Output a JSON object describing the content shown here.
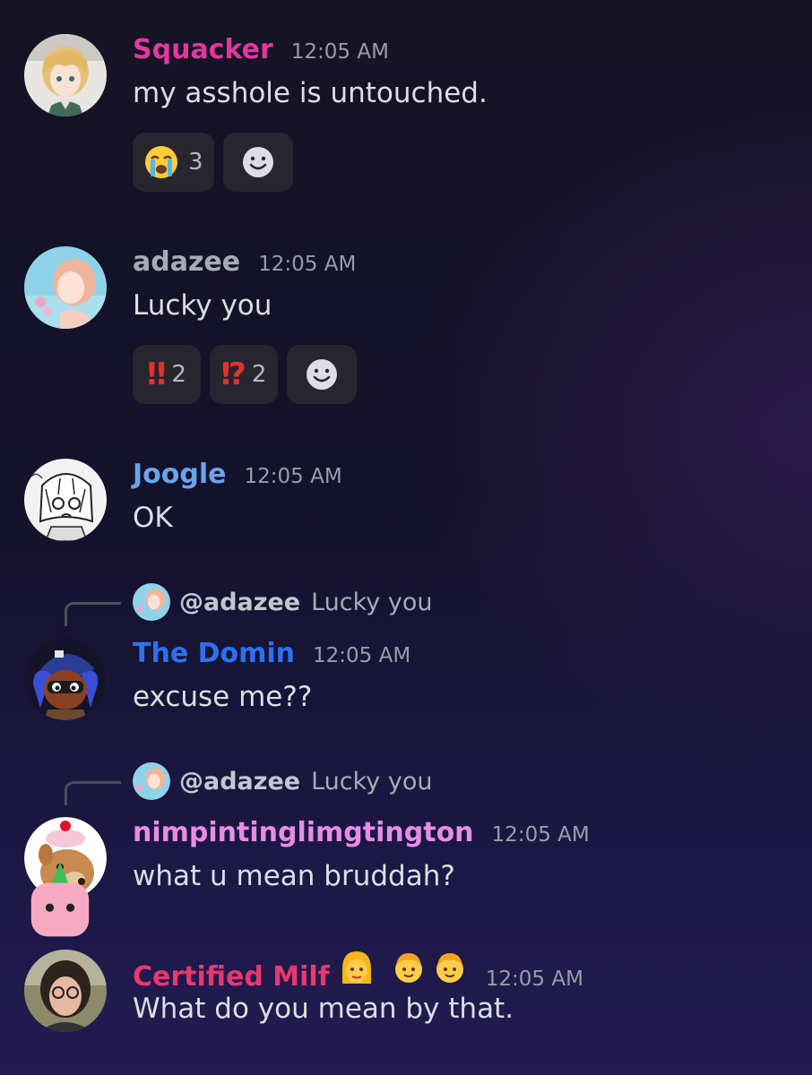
{
  "messages": [
    {
      "username": "Squacker",
      "timestamp": "12:05 AM",
      "text": "my asshole is untouched.",
      "reactions": [
        {
          "emoji": "loudly-crying-face",
          "count": "3"
        }
      ]
    },
    {
      "username": "adazee",
      "timestamp": "12:05 AM",
      "text": "Lucky you",
      "reactions": [
        {
          "emoji": "‼",
          "count": "2"
        },
        {
          "emoji": "⁉",
          "count": "2"
        }
      ]
    },
    {
      "username": "Joogle",
      "timestamp": "12:05 AM",
      "text": "OK"
    },
    {
      "reply": {
        "name": "@adazee",
        "text": "Lucky you"
      },
      "username": "The Domin",
      "timestamp": "12:05 AM",
      "text": "excuse me??"
    },
    {
      "reply": {
        "name": "@adazee",
        "text": "Lucky you"
      },
      "username": "nimpintinglimgtington",
      "timestamp": "12:05 AM",
      "text": "what u mean bruddah?"
    },
    {
      "username": "Certified Milf",
      "timestamp": "12:05 AM",
      "text": "What do you mean by that.",
      "name_emojis": [
        "woman-blond-hair",
        "child-blond",
        "child-blond"
      ]
    }
  ],
  "colors": {
    "squacker": "#e0399c",
    "adazee": "#a6abb6",
    "joogle": "#6aa3ee",
    "the_domin": "#2c72ee",
    "nimpintinglimgtington": "#e98ce6",
    "certified_milf": "#e8386e",
    "timestamp": "#9a9ca8",
    "reaction_bg": "#27262f"
  }
}
